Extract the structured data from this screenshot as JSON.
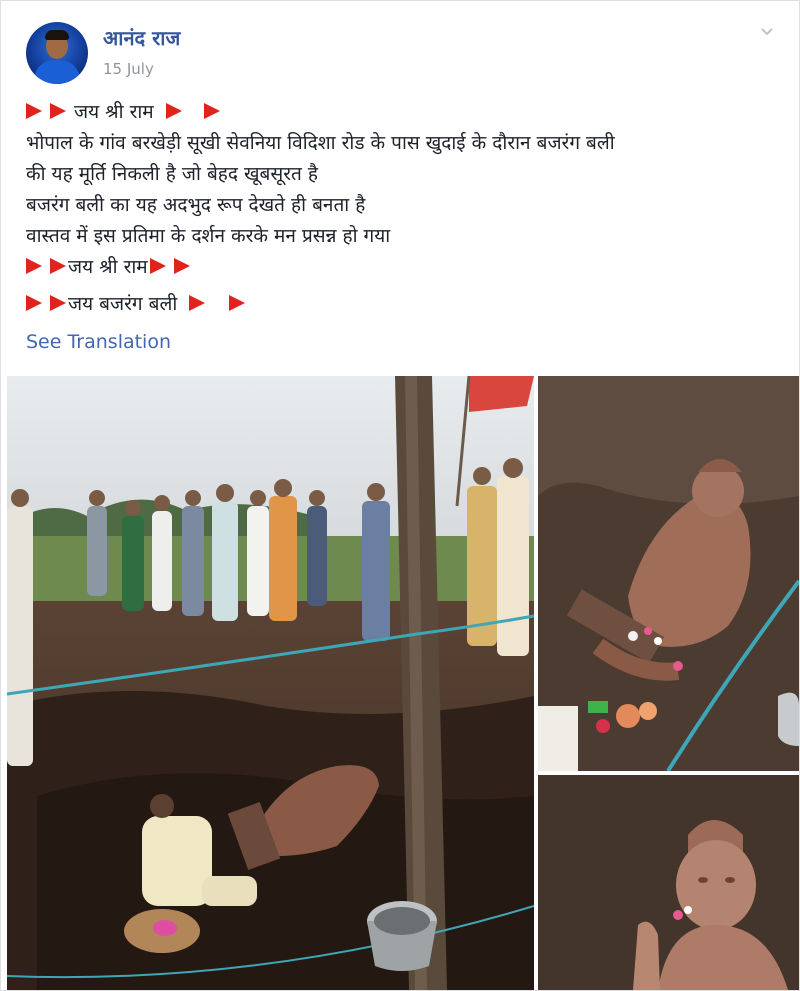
{
  "post": {
    "author": "आनंद राज",
    "date": "15 July",
    "lines": [
      "जय श्री राम",
      "भोपाल के गांव बरखेड़ी सूखी सेवनिया विदिशा रोड के पास खुदाई के दौरान बजरंग बली",
      "की यह मूर्ति निकली है जो बेहद खूबसूरत है",
      "बजरंग बली का यह अदभुद रूप देखते ही बनता है",
      "वास्तव में इस प्रतिमा के दर्शन करके मन प्रसन्न हो गया",
      "जय श्री राम",
      "जय बजरंग बली"
    ],
    "see_translation": "See Translation"
  },
  "icons": {
    "flag": "red-flag-icon",
    "menu": "chevron-down-icon"
  },
  "colors": {
    "author_link": "#365899",
    "link": "#4267b2",
    "meta_text": "#90949c",
    "flag_red": "#e0241b"
  }
}
